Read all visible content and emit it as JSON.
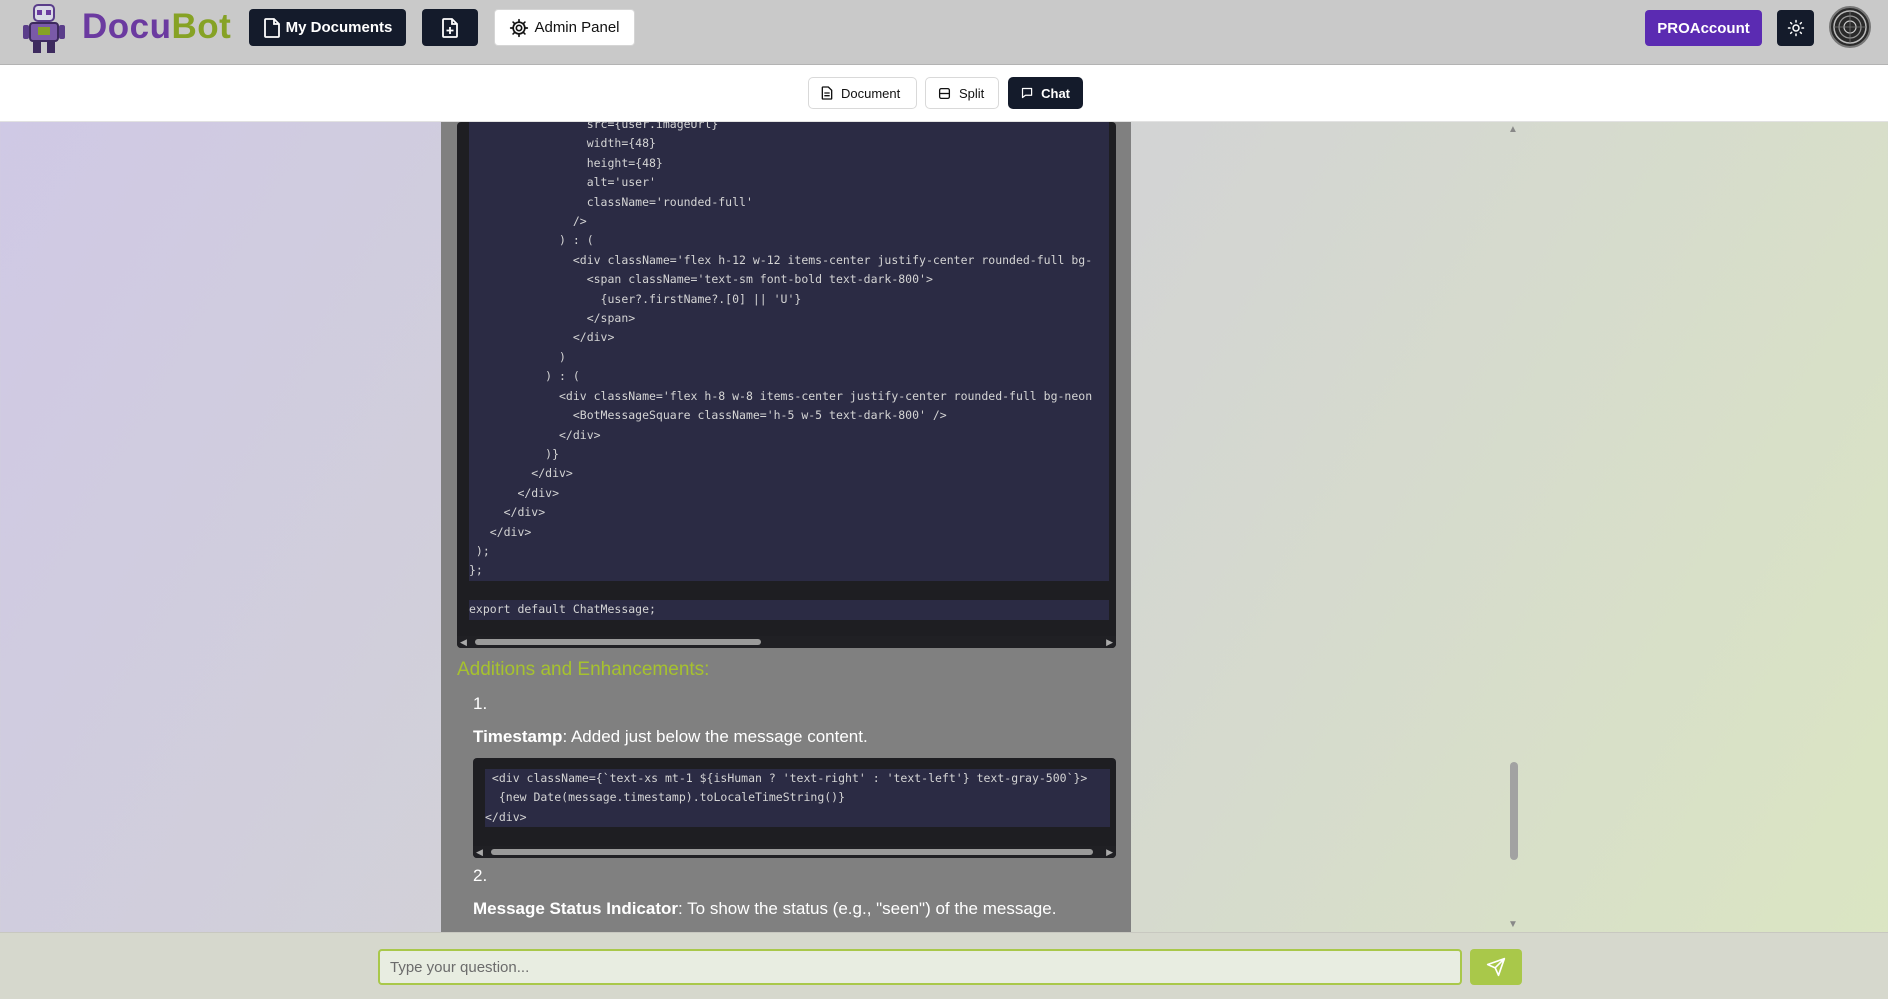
{
  "brand": {
    "part1": "Docu",
    "part2": "Bot"
  },
  "nav": {
    "my_documents": "My Documents",
    "admin_panel": "Admin Panel",
    "pro_account": "PROAccount"
  },
  "view_tabs": [
    {
      "label": "Document",
      "active": false
    },
    {
      "label": "Split",
      "active": false
    },
    {
      "label": "Chat",
      "active": true
    }
  ],
  "code_block_1": [
    "                 src={user.imageUrl}",
    "                 width={48}",
    "                 height={48}",
    "                 alt='user'",
    "                 className='rounded-full'",
    "               />",
    "             ) : (",
    "               <div className='flex h-12 w-12 items-center justify-center rounded-full bg-",
    "                 <span className='text-sm font-bold text-dark-800'>",
    "                   {user?.firstName?.[0] || 'U'}",
    "                 </span>",
    "               </div>",
    "             )",
    "           ) : (",
    "             <div className='flex h-8 w-8 items-center justify-center rounded-full bg-neon",
    "               <BotMessageSquare className='h-5 w-5 text-dark-800' />",
    "             </div>",
    "           )}",
    "         </div>",
    "       </div>",
    "     </div>",
    "   </div>",
    " );",
    "};",
    "",
    "export default ChatMessage;"
  ],
  "section_heading": "Additions and Enhancements:",
  "steps": [
    {
      "number": "1.",
      "title": "Timestamp",
      "text": ": Added just below the message content."
    },
    {
      "number": "2.",
      "title": "Message Status Indicator",
      "text": ": To show the status (e.g., \"seen\") of the message."
    }
  ],
  "code_block_2": [
    " <div className={`text-xs mt-1 ${isHuman ? 'text-right' : 'text-left'} text-gray-500`}>",
    "  {new Date(message.timestamp).toLocaleTimeString()}",
    "</div>"
  ],
  "input": {
    "placeholder": "Type your question...",
    "value": ""
  },
  "icons": {
    "document": "file-icon",
    "new_document": "file-plus-icon",
    "admin": "gear-icon",
    "theme": "sun-icon",
    "split": "split-icon",
    "chat": "message-square-icon",
    "send": "send-icon"
  },
  "colors": {
    "brand_purple": "#6b3aa0",
    "brand_green": "#86a225",
    "pro_button": "#5b2bb2",
    "accent_green": "#a9c84a",
    "nav_dark": "#141b2b"
  }
}
